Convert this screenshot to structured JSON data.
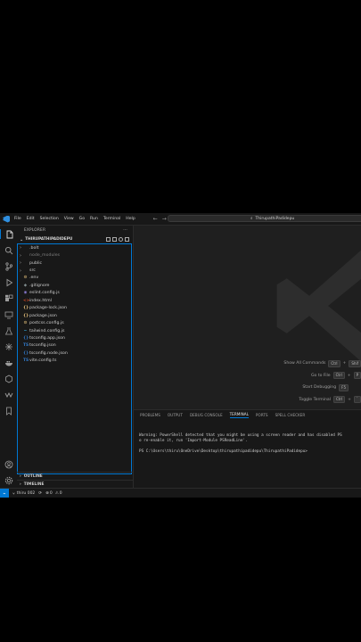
{
  "titlebar": {
    "menu": [
      "File",
      "Edit",
      "Selection",
      "View",
      "Go",
      "Run",
      "Terminal",
      "Help"
    ],
    "search_text": "ThirupathiPadidepu"
  },
  "sidebar": {
    "title": "EXPLORER",
    "more": "···",
    "folder": "THIRUPATHIPADIDEPU",
    "items": [
      {
        "chev": "›",
        "icon": "",
        "label": ".bolt",
        "dim": false
      },
      {
        "chev": "›",
        "icon": "",
        "label": "node_modules",
        "dim": true
      },
      {
        "chev": "›",
        "icon": "",
        "label": "public",
        "dim": false
      },
      {
        "chev": "›",
        "icon": "",
        "label": "src",
        "dim": false
      },
      {
        "chev": "",
        "icon": "⚙",
        "label": ".env",
        "dim": false,
        "color": "#e5c07b"
      },
      {
        "chev": "",
        "icon": "◆",
        "label": ".gitignore",
        "dim": false,
        "color": "#7f8c8d"
      },
      {
        "chev": "",
        "icon": "◉",
        "label": "eslint.config.js",
        "dim": false,
        "color": "#8a7bd4"
      },
      {
        "chev": "",
        "icon": "<>",
        "label": "index.html",
        "dim": false,
        "color": "#e44d26"
      },
      {
        "chev": "",
        "icon": "{}",
        "label": "package-lock.json",
        "dim": false,
        "color": "#e5c07b"
      },
      {
        "chev": "",
        "icon": "{}",
        "label": "package.json",
        "dim": false,
        "color": "#e5c07b"
      },
      {
        "chev": "",
        "icon": "⚙",
        "label": "postcss.config.js",
        "dim": false,
        "color": "#e5c07b"
      },
      {
        "chev": "",
        "icon": "~",
        "label": "tailwind.config.js",
        "dim": false,
        "color": "#38bdf8"
      },
      {
        "chev": "",
        "icon": "{}",
        "label": "tsconfig.app.json",
        "dim": false,
        "color": "#3178c6"
      },
      {
        "chev": "",
        "icon": "TS",
        "label": "tsconfig.json",
        "dim": false,
        "color": "#3178c6"
      },
      {
        "chev": "",
        "icon": "{}",
        "label": "tsconfig.node.json",
        "dim": false,
        "color": "#3178c6"
      },
      {
        "chev": "",
        "icon": "TS",
        "label": "vite.config.ts",
        "dim": false,
        "color": "#3178c6"
      }
    ],
    "outline": "OUTLINE",
    "timeline": "TIMELINE"
  },
  "editor": {
    "hints": [
      {
        "label": "Show All Commands",
        "keys": [
          "Ctrl",
          "+",
          "Shif"
        ]
      },
      {
        "label": "Go to File",
        "keys": [
          "Ctrl",
          "+",
          "P"
        ]
      },
      {
        "label": "Start Debugging",
        "keys": [
          "F5"
        ]
      },
      {
        "label": "Toggle Terminal",
        "keys": [
          "Ctrl",
          "+",
          "`"
        ]
      }
    ]
  },
  "panel": {
    "tabs": [
      "PROBLEMS",
      "OUTPUT",
      "DEBUG CONSOLE",
      "TERMINAL",
      "PORTS",
      "SPELL CHECKER"
    ],
    "active_tab": "TERMINAL",
    "terminal_lines": [
      "Warning: PowerShell detected that you might be using a screen reader and has disabled PS",
      "o re-enable it, run 'Import-Module PSReadLine'.",
      "",
      "PS C:\\Users\\thiru\\OneDrive\\Desktop\\thirupathipadidepu\\ThirupathiPadidepu>"
    ]
  },
  "statusbar": {
    "branch": "thiru 002",
    "errors": "0",
    "warnings": "0"
  },
  "colors": {
    "accent": "#0078d4",
    "bg": "#1f1f1f",
    "sidebar_bg": "#181818"
  }
}
